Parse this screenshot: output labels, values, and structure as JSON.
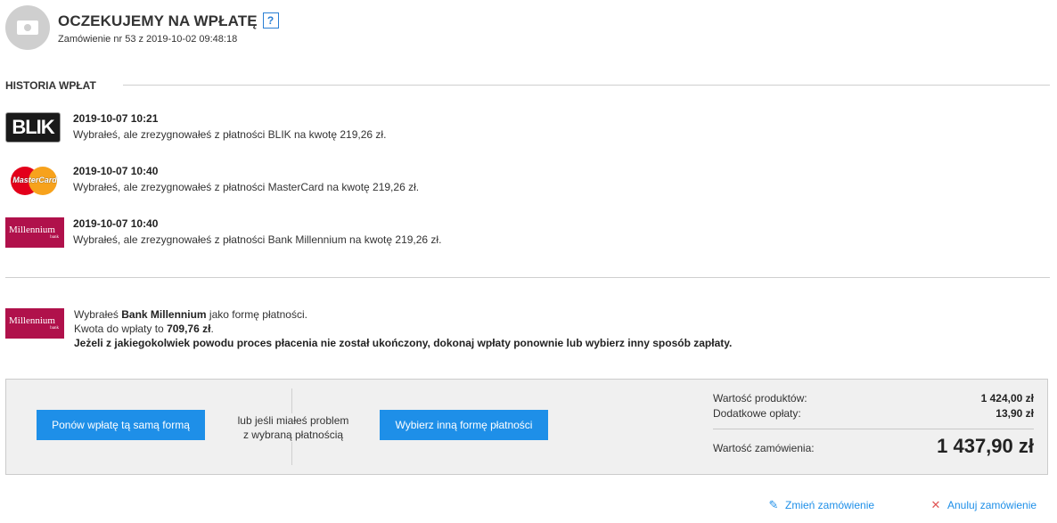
{
  "header": {
    "title": "OCZEKUJEMY NA WPŁATĘ",
    "help": "?",
    "order_info": "Zamówienie nr 53 z 2019-10-02 09:48:18",
    "icon": "money-bill-icon"
  },
  "history": {
    "title": "HISTORIA WPŁAT",
    "items": [
      {
        "logo": "BLIK",
        "date": "2019-10-07 10:21",
        "text": "Wybrałeś, ale zrezygnowałeś z płatności BLIK na kwotę 219,26 zł."
      },
      {
        "logo": "MasterCard",
        "date": "2019-10-07 10:40",
        "text": "Wybrałeś, ale zrezygnowałeś z płatności MasterCard na kwotę 219,26 zł."
      },
      {
        "logo": "Millennium",
        "logo_sub": "bank",
        "date": "2019-10-07 10:40",
        "text": "Wybrałeś, ale zrezygnowałeś z płatności Bank Millennium na kwotę 219,26 zł."
      }
    ]
  },
  "selected": {
    "logo": "Millennium",
    "logo_sub": "bank",
    "line1_prefix": "Wybrałeś ",
    "line1_bold": "Bank Millennium",
    "line1_suffix": " jako formę płatności.",
    "line2_prefix": "Kwota do wpłaty to ",
    "line2_bold": "709,76 zł",
    "line2_suffix": ".",
    "line3": "Jeżeli z jakiegokolwiek powodu proces płacenia nie został ukończony, dokonaj wpłaty ponownie lub wybierz inny sposób zapłaty."
  },
  "actions": {
    "retry_label": "Ponów wpłatę tą samą formą",
    "or_line1": "lub jeśli miałeś problem",
    "or_line2": "z wybraną płatnością",
    "other_label": "Wybierz inną formę płatności"
  },
  "summary": {
    "products_label": "Wartość produktów:",
    "products_value": "1 424,00 zł",
    "fees_label": "Dodatkowe opłaty:",
    "fees_value": "13,90 zł",
    "total_label": "Wartość zamówienia:",
    "total_value": "1 437,90 zł"
  },
  "links": {
    "edit_label": "Zmień zamówienie",
    "cancel_label": "Anuluj zamówienie"
  },
  "colors": {
    "accent": "#1e8fe8",
    "millennium": "#b0114b",
    "cancel": "#e05555"
  }
}
